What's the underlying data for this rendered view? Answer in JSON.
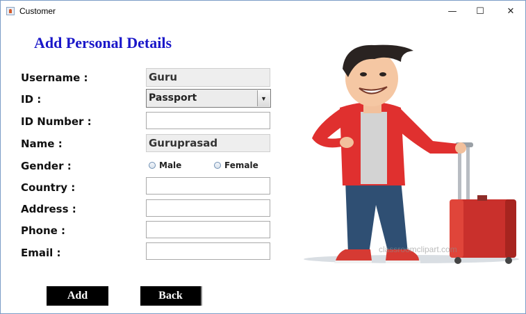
{
  "window": {
    "title": "Customer",
    "icon": "java-cup-icon",
    "controls": {
      "minimize": "—",
      "maximize": "☐",
      "close": "✕"
    }
  },
  "heading": "Add Personal Details",
  "labels": {
    "username": "Username :",
    "id": "ID :",
    "id_number": "ID Number :",
    "name": "Name :",
    "gender": "Gender :",
    "country": "Country :",
    "address": "Address :",
    "phone": "Phone :",
    "email": "Email :"
  },
  "fields": {
    "username": "Guru",
    "id_type": "Passport",
    "id_number": "",
    "name": "Guruprasad",
    "country": "",
    "address": "",
    "phone": "",
    "email": ""
  },
  "gender_options": {
    "male": "Male",
    "female": "Female"
  },
  "buttons": {
    "add": "Add",
    "back": "Back"
  },
  "illustration": {
    "watermark": "classroomclipart.com"
  },
  "colors": {
    "heading": "#1a17c9",
    "button_bg": "#000000",
    "shirt": "#e0302f",
    "jeans": "#2f4f73",
    "suitcase": "#c9302c"
  }
}
